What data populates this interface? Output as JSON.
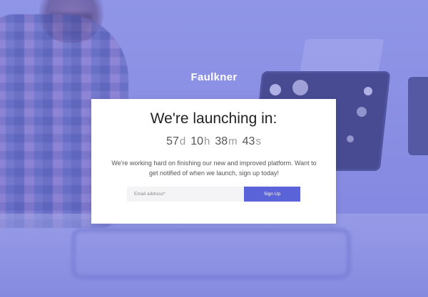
{
  "brand": {
    "name": "Faulkner"
  },
  "launch": {
    "heading": "We're launching in:",
    "countdown": [
      {
        "value": "57",
        "unit": "d"
      },
      {
        "value": "10",
        "unit": "h"
      },
      {
        "value": "38",
        "unit": "m"
      },
      {
        "value": "43",
        "unit": "s"
      }
    ],
    "description": "We're working hard on finishing our new and improved platform. Want to get notified of when we launch, sign up today!"
  },
  "form": {
    "email_placeholder": "Email address*",
    "submit_label": "Sign Up"
  },
  "colors": {
    "overlay": "#8f93e0",
    "button": "#5b63d9",
    "card": "#ffffff"
  }
}
